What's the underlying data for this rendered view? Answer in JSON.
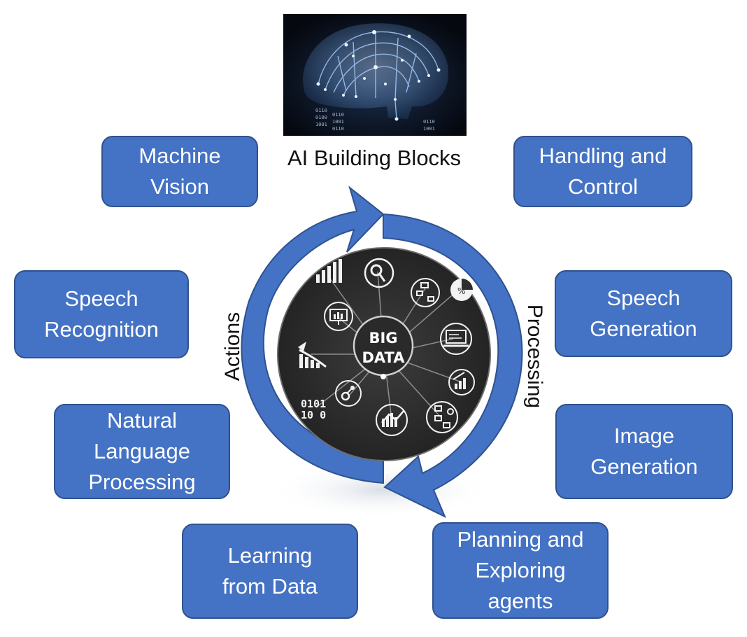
{
  "title": "AI Building Blocks",
  "cycle_labels": {
    "left": "Actions",
    "right": "Processing"
  },
  "center": {
    "line1": "BIG",
    "line2": "DATA"
  },
  "brain_digits": [
    "0110",
    "0100",
    "1001",
    "0110",
    "1001",
    "0110",
    "0110",
    "1001"
  ],
  "center_icon_digits": {
    "line1": "0101",
    "line2": "10 0"
  },
  "colors": {
    "box_fill": "#4472c4",
    "box_border": "#2f528f",
    "arrow": "#4472c4",
    "hub": "#2e2e2e"
  },
  "boxes": {
    "machine_vision": [
      "Machine",
      "Vision"
    ],
    "handling_control": [
      "Handling and",
      "Control"
    ],
    "speech_recognition": [
      "Speech",
      "Recognition"
    ],
    "speech_generation": [
      "Speech",
      "Generation"
    ],
    "natural_language": [
      "Natural",
      "Language",
      "Processing"
    ],
    "image_generation": [
      "Image",
      "Generation"
    ],
    "learning_data": [
      "Learning",
      "from Data"
    ],
    "planning_agents": [
      "Planning and",
      "Exploring",
      "agents"
    ]
  },
  "hub_icons": [
    "bar-chart-icon",
    "magnifier-chart-icon",
    "flowchart-icon",
    "pie-chart-icon",
    "monitor-chart-icon",
    "laptop-icon",
    "growth-arrow-icon",
    "rising-bars-icon",
    "network-nodes-icon",
    "binary-icon",
    "trend-chart-icon",
    "process-flow-icon"
  ]
}
